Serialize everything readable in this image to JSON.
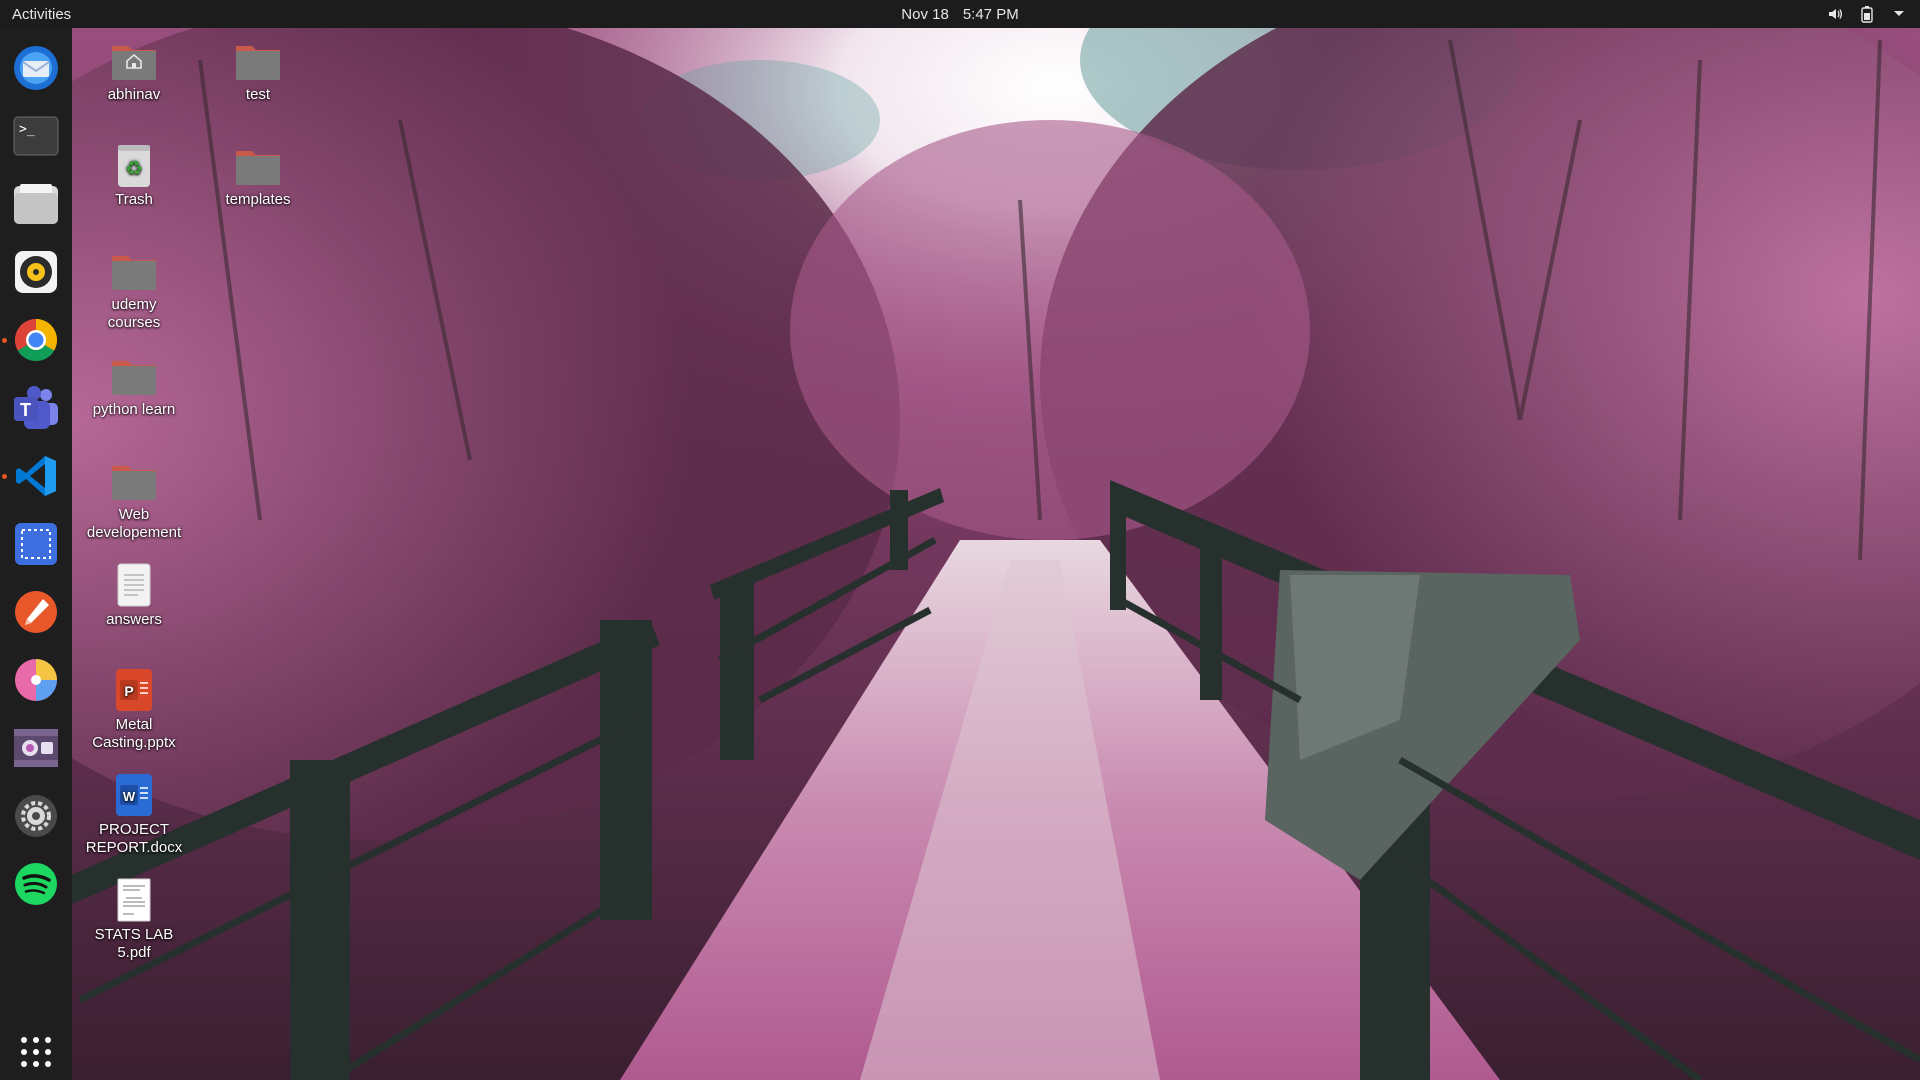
{
  "topbar": {
    "activities": "Activities",
    "date": "Nov 18",
    "time": "5:47 PM",
    "tray_icons": [
      "speaker-icon",
      "battery-icon",
      "chevron-down-icon"
    ]
  },
  "dock": {
    "items": [
      {
        "name": "thunderbird-mail",
        "icon": "mail-icon",
        "running": false
      },
      {
        "name": "terminal",
        "icon": "terminal-icon",
        "running": false
      },
      {
        "name": "files",
        "icon": "folder-icon",
        "running": false
      },
      {
        "name": "rhythmbox",
        "icon": "music-icon",
        "running": false
      },
      {
        "name": "google-chrome",
        "icon": "chrome-icon",
        "running": true
      },
      {
        "name": "microsoft-teams",
        "icon": "teams-icon",
        "running": false
      },
      {
        "name": "visual-studio-code",
        "icon": "vscode-icon",
        "running": true
      },
      {
        "name": "screenshot-tool",
        "icon": "selection-icon",
        "running": false
      },
      {
        "name": "color-picker",
        "icon": "color-picker-icon",
        "running": false
      },
      {
        "name": "disk-usage-analyzer",
        "icon": "pie-chart-icon",
        "running": false
      },
      {
        "name": "video-player",
        "icon": "video-icon",
        "running": false
      },
      {
        "name": "settings",
        "icon": "gear-icon",
        "running": false
      },
      {
        "name": "spotify",
        "icon": "spotify-icon",
        "running": false
      },
      {
        "name": "show-applications",
        "icon": "app-grid-icon",
        "running": false
      }
    ]
  },
  "desktop": {
    "icons": [
      {
        "label": "abhinav",
        "type": "home-folder"
      },
      {
        "label": "test",
        "type": "folder"
      },
      {
        "label": "Trash",
        "type": "trash"
      },
      {
        "label": "templates",
        "type": "folder"
      },
      {
        "label": "udemy courses",
        "type": "folder"
      },
      {
        "label": "python learn",
        "type": "folder"
      },
      {
        "label": "Web\ndevelopement",
        "type": "folder"
      },
      {
        "label": "answers",
        "type": "text-document"
      },
      {
        "label": "Metal\nCasting.pptx",
        "type": "powerpoint"
      },
      {
        "label": "PROJECT\nREPORT.docx",
        "type": "word"
      },
      {
        "label": "STATS LAB\n5.pdf",
        "type": "pdf"
      }
    ]
  },
  "colors": {
    "topbar_bg": "#1c1c1c",
    "dock_bg": "#1e1e1e",
    "running_indicator": "#e95420",
    "folder_tab": "#c75a4a",
    "folder_body": "#7a7a7a"
  }
}
